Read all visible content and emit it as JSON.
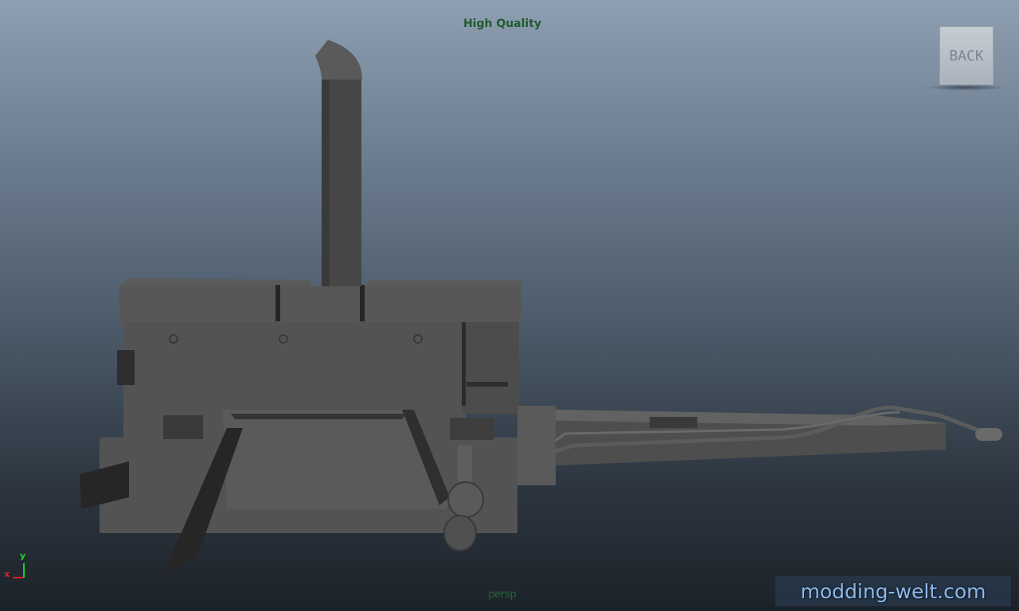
{
  "viewport": {
    "renderer_label": "High Quality",
    "camera_label": "persp",
    "background_top": "#8f9fb2",
    "background_bottom": "#1c2229",
    "model_color": "#575757"
  },
  "controls": {
    "back_label": "BACK"
  },
  "axis_gizmo": {
    "x_label": "x",
    "y_label": "y",
    "x_color": "#e02020",
    "y_color": "#20d020"
  },
  "watermark": {
    "text": "modding-welt.com"
  }
}
